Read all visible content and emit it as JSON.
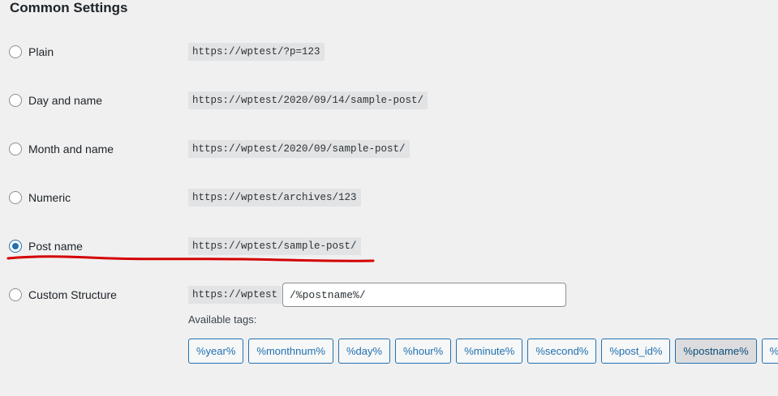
{
  "section": {
    "title": "Common Settings"
  },
  "options": [
    {
      "label": "Plain",
      "example": "https://wptest/?p=123",
      "checked": false
    },
    {
      "label": "Day and name",
      "example": "https://wptest/2020/09/14/sample-post/",
      "checked": false
    },
    {
      "label": "Month and name",
      "example": "https://wptest/2020/09/sample-post/",
      "checked": false
    },
    {
      "label": "Numeric",
      "example": "https://wptest/archives/123",
      "checked": false
    },
    {
      "label": "Post name",
      "example": "https://wptest/sample-post/",
      "checked": true
    }
  ],
  "custom": {
    "label": "Custom Structure",
    "prefix": "https://wptest",
    "value": "/%postname%/"
  },
  "available_tags": {
    "label": "Available tags:",
    "tags": [
      "%year%",
      "%monthnum%",
      "%day%",
      "%hour%",
      "%minute%",
      "%second%",
      "%post_id%",
      "%postname%",
      "%c"
    ],
    "active_tag": "%postname%"
  },
  "colors": {
    "accent": "#2271b1",
    "annotation": "#d40000"
  }
}
